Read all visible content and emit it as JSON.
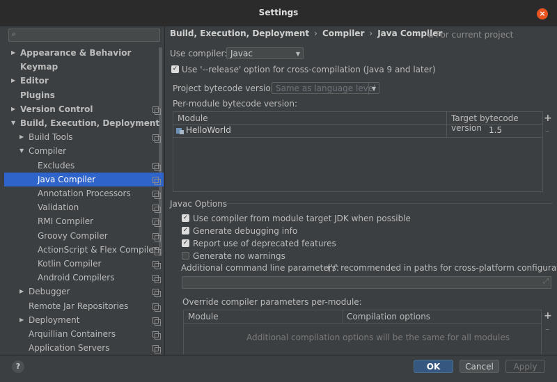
{
  "window": {
    "title": "Settings"
  },
  "sidebar": {
    "search_placeholder": "",
    "items": [
      {
        "label": "Appearance & Behavior",
        "bold": true,
        "arrow": "right"
      },
      {
        "label": "Keymap",
        "bold": true
      },
      {
        "label": "Editor",
        "bold": true,
        "arrow": "right"
      },
      {
        "label": "Plugins",
        "bold": true
      },
      {
        "label": "Version Control",
        "bold": true,
        "arrow": "right"
      },
      {
        "label": "Build, Execution, Deployment",
        "bold": true,
        "arrow": "down"
      },
      {
        "label": "Build Tools",
        "arrow": "right"
      },
      {
        "label": "Compiler",
        "arrow": "down"
      },
      {
        "label": "Excludes"
      },
      {
        "label": "Java Compiler",
        "selected": true
      },
      {
        "label": "Annotation Processors"
      },
      {
        "label": "Validation"
      },
      {
        "label": "RMI Compiler"
      },
      {
        "label": "Groovy Compiler"
      },
      {
        "label": "ActionScript & Flex Compiler"
      },
      {
        "label": "Kotlin Compiler"
      },
      {
        "label": "Android Compilers"
      },
      {
        "label": "Debugger",
        "arrow": "right"
      },
      {
        "label": "Remote Jar Repositories"
      },
      {
        "label": "Deployment",
        "arrow": "right"
      },
      {
        "label": "Arquillian Containers"
      },
      {
        "label": "Application Servers"
      }
    ]
  },
  "breadcrumb": {
    "items": [
      "Build, Execution, Deployment",
      "Compiler",
      "Java Compiler"
    ],
    "scope": "For current project"
  },
  "compiler": {
    "use_compiler_label": "Use compiler:",
    "use_compiler_value": "Javac",
    "release_option": {
      "label": "Use '--release' option for cross-compilation (Java 9 and later)",
      "checked": true
    },
    "project_bytecode_label": "Project bytecode version:",
    "project_bytecode_value": "Same as language level",
    "per_module_label": "Per-module bytecode version:",
    "module_table": {
      "columns": [
        "Module",
        "Target bytecode version"
      ],
      "rows": [
        {
          "module": "HelloWorld",
          "version": "1.5"
        }
      ]
    }
  },
  "javac": {
    "section_title": "Javac Options",
    "options": [
      {
        "label": "Use compiler from module target JDK when possible",
        "checked": true
      },
      {
        "label": "Generate debugging info",
        "checked": true
      },
      {
        "label": "Report use of deprecated features",
        "checked": true
      },
      {
        "label": "Generate no warnings",
        "checked": false
      }
    ],
    "cmdline_label": "Additional command line parameters:",
    "cmdline_hint": "('/' recommended in paths for cross-platform configurations)",
    "cmdline_value": "",
    "override_label": "Override compiler parameters per-module:",
    "override_table": {
      "columns": [
        "Module",
        "Compilation options"
      ],
      "empty_text": "Additional compilation options will be the same for all modules"
    }
  },
  "footer": {
    "help": "?",
    "ok": "OK",
    "cancel": "Cancel",
    "apply": "Apply"
  },
  "colors": {
    "selection": "#2f65ca",
    "ok_button": "#365880",
    "close_button": "#e95420"
  }
}
